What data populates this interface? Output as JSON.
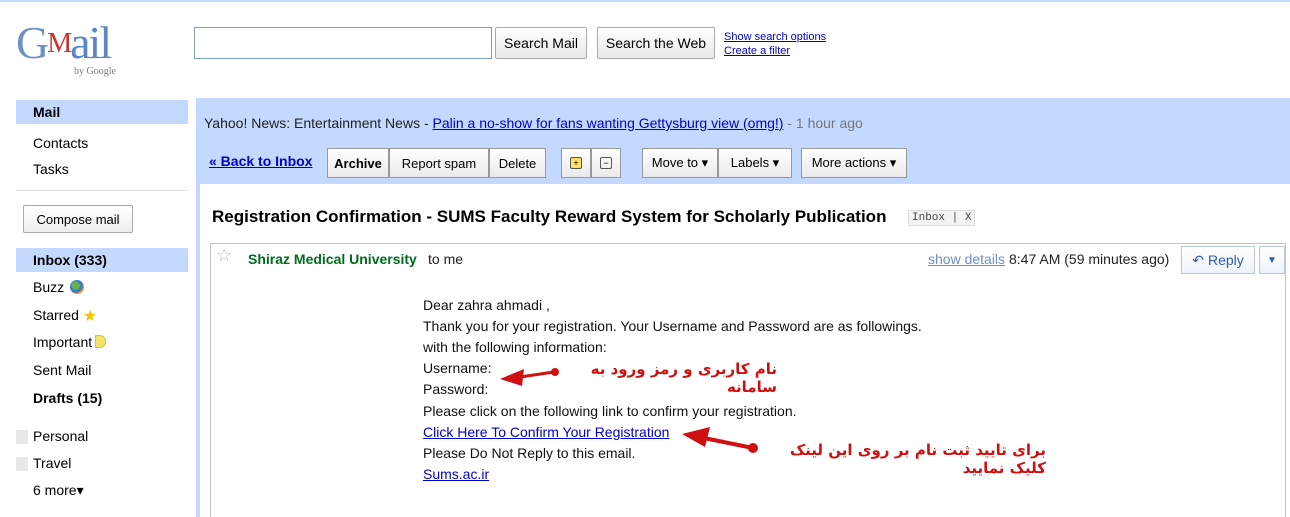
{
  "logo": {
    "brand": "Gmail",
    "byline": "by Google"
  },
  "search": {
    "query": "",
    "search_mail": "Search Mail",
    "search_web": "Search the Web",
    "options_link": "Show search options",
    "filter_link": "Create a filter"
  },
  "sidebar": {
    "mail": "Mail",
    "contacts": "Contacts",
    "tasks": "Tasks",
    "compose": "Compose mail",
    "inbox": "Inbox (333)",
    "buzz": "Buzz",
    "starred": "Starred",
    "important": "Important",
    "sent": "Sent Mail",
    "drafts": "Drafts (15)",
    "labels": [
      "Personal",
      "Travel"
    ],
    "more": "6 more▾"
  },
  "news": {
    "prefix": "Yahoo! News: Entertainment News - ",
    "headline": "Palin a no-show for fans wanting Gettysburg view (omg!)",
    "time": " - 1 hour ago"
  },
  "toolbar": {
    "back": "« Back to Inbox",
    "archive": "Archive",
    "spam": "Report spam",
    "delete": "Delete",
    "move_to": "Move to ▾",
    "labels": "Labels ▾",
    "more_actions": "More actions ▾"
  },
  "message": {
    "subject": "Registration Confirmation - SUMS Faculty Reward System for Scholarly Publication",
    "tag": "Inbox",
    "tag_close": "X",
    "sender": "Shiraz Medical University",
    "recipient": "to me",
    "show_details": "show details",
    "time": "8:47 AM (59 minutes ago)",
    "reply": "Reply",
    "body": {
      "greeting": "Dear zahra ahmadi ,",
      "line1": "Thank you for your registration. Your Username and Password are as followings.",
      "line2": "with the following information:",
      "username": "Username:",
      "password": "Password:",
      "line3": "Please click on the following link to confirm your registration.",
      "confirm_link": "Click Here To Confirm Your Registration",
      "line4": "Please Do Not Reply to this email.",
      "site_link": "Sums.ac.ir"
    }
  },
  "annotations": {
    "credentials": "نام کاربری و رمز ورود به سامانه",
    "confirm": "برای تایید ثبت نام بر روی این لینک کلیک نمایید",
    "color": "#d01010"
  }
}
